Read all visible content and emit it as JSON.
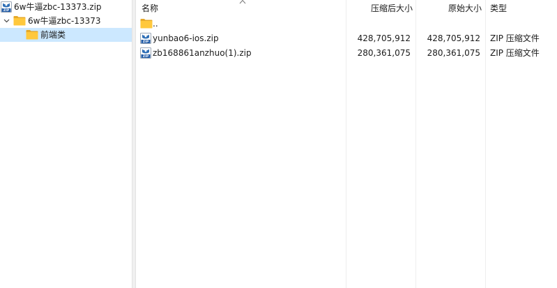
{
  "tree": {
    "root": {
      "label": "6w牛逼zbc-13373.zip",
      "icon": "zip-archive-icon"
    },
    "child": {
      "label": "6w牛逼zbc-13373",
      "icon": "folder-icon",
      "expanded": true
    },
    "grandchild": {
      "label": "前端类",
      "icon": "folder-icon",
      "selected": true
    }
  },
  "columns": {
    "name": "名称",
    "compressed": "压缩后大小",
    "original": "原始大小",
    "type": "类型"
  },
  "files": [
    {
      "name": "..",
      "compressed": "",
      "original": "",
      "type": "",
      "icon": "folder-icon"
    },
    {
      "name": "yunbao6-ios.zip",
      "compressed": "428,705,912",
      "original": "428,705,912",
      "type": "ZIP 压缩文件",
      "icon": "zip-archive-icon"
    },
    {
      "name": "zb168861anzhuo(1).zip",
      "compressed": "280,361,075",
      "original": "280,361,075",
      "type": "ZIP 压缩文件",
      "icon": "zip-archive-icon"
    }
  ],
  "colors": {
    "selection": "#cce8ff",
    "folder": "#ffc83d",
    "zip_blue": "#2f6fb6"
  }
}
